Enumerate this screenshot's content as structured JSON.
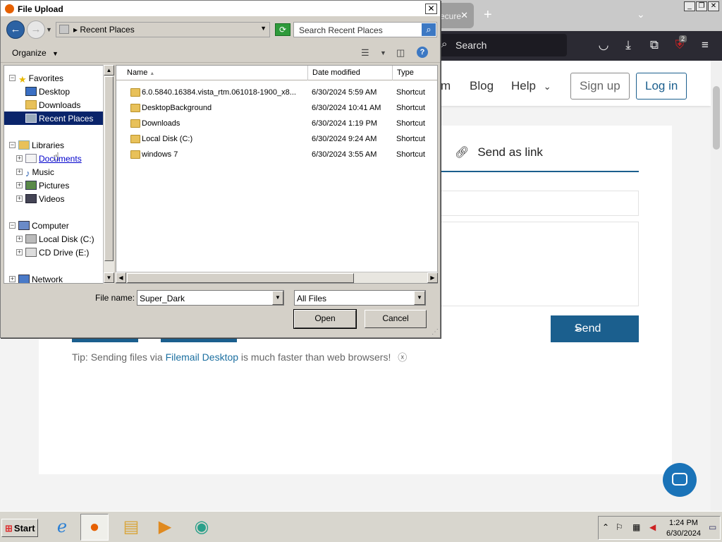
{
  "browser": {
    "tab_title": "ecure",
    "search_placeholder": "Search",
    "extension_badge": "2"
  },
  "site": {
    "nav": {
      "partial_link": "m",
      "blog": "Blog",
      "help": "Help",
      "signup": "Sign up",
      "login": "Log in"
    },
    "tab_send_link": "Send as link",
    "send_button": "Send",
    "tip": {
      "prefix": "Tip: Sending files via ",
      "link": "Filemail Desktop",
      "suffix": " is much faster than web browsers!"
    }
  },
  "dialog": {
    "title": "File Upload",
    "address_path": "Recent Places",
    "search_placeholder": "Search Recent Places",
    "organize": "Organize",
    "tree": {
      "favorites": "Favorites",
      "desktop": "Desktop",
      "downloads": "Downloads",
      "recent_places": "Recent Places",
      "libraries": "Libraries",
      "documents": "Documents",
      "music": "Music",
      "pictures": "Pictures",
      "videos": "Videos",
      "computer": "Computer",
      "local_disk": "Local Disk (C:)",
      "cd_drive": "CD Drive (E:)",
      "network": "Network"
    },
    "columns": {
      "name": "Name",
      "date": "Date modified",
      "type": "Type"
    },
    "files": [
      {
        "name": "6.0.5840.16384.vista_rtm.061018-1900_x8...",
        "date": "6/30/2024 5:59 AM",
        "type": "Shortcut"
      },
      {
        "name": "DesktopBackground",
        "date": "6/30/2024 10:41 AM",
        "type": "Shortcut"
      },
      {
        "name": "Downloads",
        "date": "6/30/2024 1:19 PM",
        "type": "Shortcut"
      },
      {
        "name": "Local Disk (C:)",
        "date": "6/30/2024 9:24 AM",
        "type": "Shortcut"
      },
      {
        "name": "windows 7",
        "date": "6/30/2024 3:55 AM",
        "type": "Shortcut"
      }
    ],
    "file_name_label": "File name:",
    "file_name_value": "Super_Dark",
    "file_type": "All Files",
    "open": "Open",
    "cancel": "Cancel"
  },
  "taskbar": {
    "start": "Start",
    "time": "1:24 PM",
    "date": "6/30/2024"
  }
}
